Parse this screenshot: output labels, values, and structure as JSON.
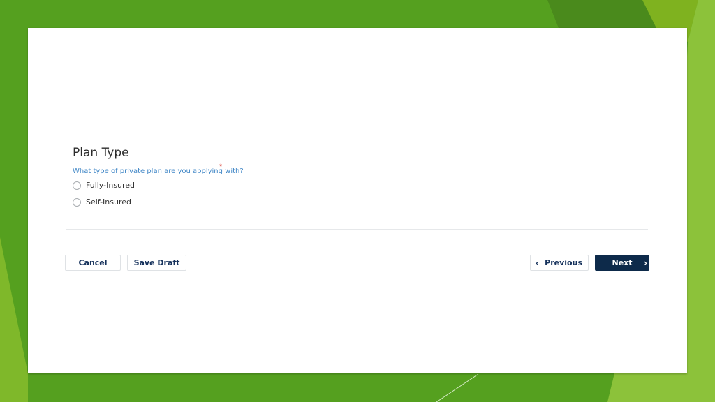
{
  "form": {
    "section_title": "Plan Type",
    "question": "What type of private plan are you applying with?",
    "required_mark": "*",
    "options": [
      {
        "label": "Fully-Insured",
        "selected": false
      },
      {
        "label": "Self-Insured",
        "selected": false
      }
    ]
  },
  "footer": {
    "cancel_label": "Cancel",
    "save_draft_label": "Save Draft",
    "previous_label": "Previous",
    "next_label": "Next"
  },
  "colors": {
    "background_green": "#55a01f",
    "primary_button": "#0d2a4a",
    "question_text": "#3f86c6",
    "required_mark": "#d9453b"
  }
}
